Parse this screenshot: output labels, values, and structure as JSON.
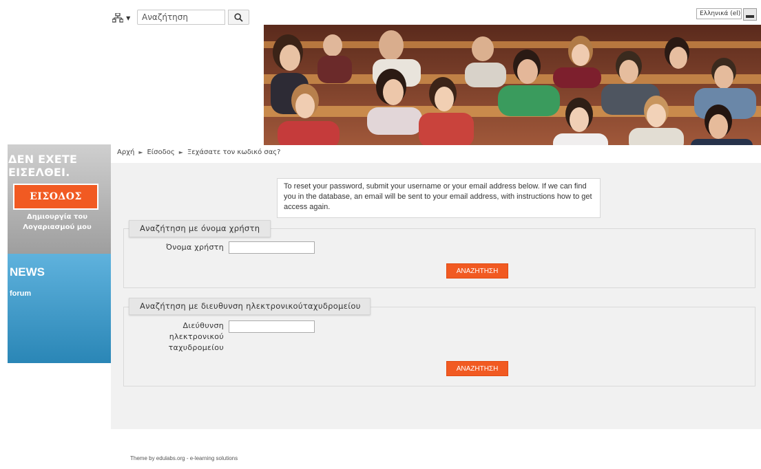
{
  "header": {
    "sitemap_icon": "sitemap-icon",
    "search": {
      "placeholder": "Αναζήτηση",
      "value": "Αναζήτηση",
      "icon": "search-icon"
    },
    "language": {
      "selected": "Ελληνικά (el)"
    }
  },
  "sidebar": {
    "login": {
      "title": "ΔΕΝ ΕΧΕΤΕ ΕΙΣΕΛΘΕΙ.",
      "login_button": "ΕΙΣΟΔΟΣ",
      "create_account": "Δημιουργία του Λογαριασμού μου"
    },
    "news": {
      "title": "NEWS",
      "link": "forum"
    }
  },
  "breadcrumb": {
    "items": [
      "Αρχή",
      "Είσοδος",
      "Ξεχάσατε τον κωδικό σας?"
    ],
    "separator": "►"
  },
  "main": {
    "info_text": "To reset your password, submit your username or your email address below. If we can find you in the database, an email will be sent to your email address, with instructions how to get access again.",
    "username_section": {
      "legend": "Αναζήτηση με όνομα χρήστη",
      "label": "Όνομα χρήστη",
      "value": "",
      "button": "ΑΝΑΖΗΤΗΣΗ"
    },
    "email_section": {
      "legend": "Αναζήτηση με διευθυνση ηλεκτρονικούταχυδρομείου",
      "label": "Διεύθυνση ηλεκτρονικού ταχυδρομείου",
      "value": "",
      "button": "ΑΝΑΖΗΤΗΣΗ"
    }
  },
  "footer": {
    "text": "Theme by edulabs.org - e-learning solutions"
  },
  "colors": {
    "accent": "#f15a22",
    "news": "#3d9acb",
    "login_bg": "#b5b5b5",
    "panel": "#f1f1f1"
  }
}
